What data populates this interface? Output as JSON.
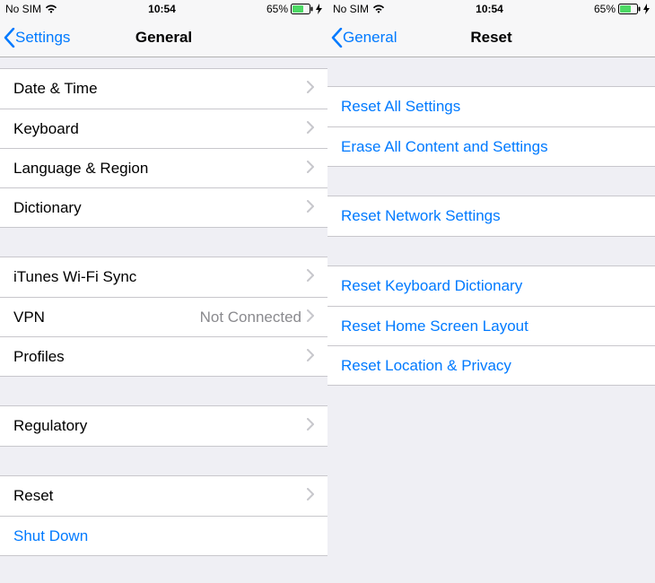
{
  "status": {
    "carrier": "No SIM",
    "time": "10:54",
    "battery_pct": "65%"
  },
  "left": {
    "back_label": "Settings",
    "title": "General",
    "groups": [
      [
        {
          "label": "Date & Time",
          "detail": "",
          "chevron": true,
          "action": false
        },
        {
          "label": "Keyboard",
          "detail": "",
          "chevron": true,
          "action": false
        },
        {
          "label": "Language & Region",
          "detail": "",
          "chevron": true,
          "action": false
        },
        {
          "label": "Dictionary",
          "detail": "",
          "chevron": true,
          "action": false
        }
      ],
      [
        {
          "label": "iTunes Wi-Fi Sync",
          "detail": "",
          "chevron": true,
          "action": false
        },
        {
          "label": "VPN",
          "detail": "Not Connected",
          "chevron": true,
          "action": false
        },
        {
          "label": "Profiles",
          "detail": "",
          "chevron": true,
          "action": false
        }
      ],
      [
        {
          "label": "Regulatory",
          "detail": "",
          "chevron": true,
          "action": false
        }
      ],
      [
        {
          "label": "Reset",
          "detail": "",
          "chevron": true,
          "action": false
        },
        {
          "label": "Shut Down",
          "detail": "",
          "chevron": false,
          "action": true
        }
      ]
    ]
  },
  "right": {
    "back_label": "General",
    "title": "Reset",
    "groups": [
      [
        {
          "label": "Reset All Settings",
          "detail": "",
          "chevron": false,
          "action": true
        },
        {
          "label": "Erase All Content and Settings",
          "detail": "",
          "chevron": false,
          "action": true
        }
      ],
      [
        {
          "label": "Reset Network Settings",
          "detail": "",
          "chevron": false,
          "action": true
        }
      ],
      [
        {
          "label": "Reset Keyboard Dictionary",
          "detail": "",
          "chevron": false,
          "action": true
        },
        {
          "label": "Reset Home Screen Layout",
          "detail": "",
          "chevron": false,
          "action": true
        },
        {
          "label": "Reset Location & Privacy",
          "detail": "",
          "chevron": false,
          "action": true
        }
      ]
    ]
  }
}
